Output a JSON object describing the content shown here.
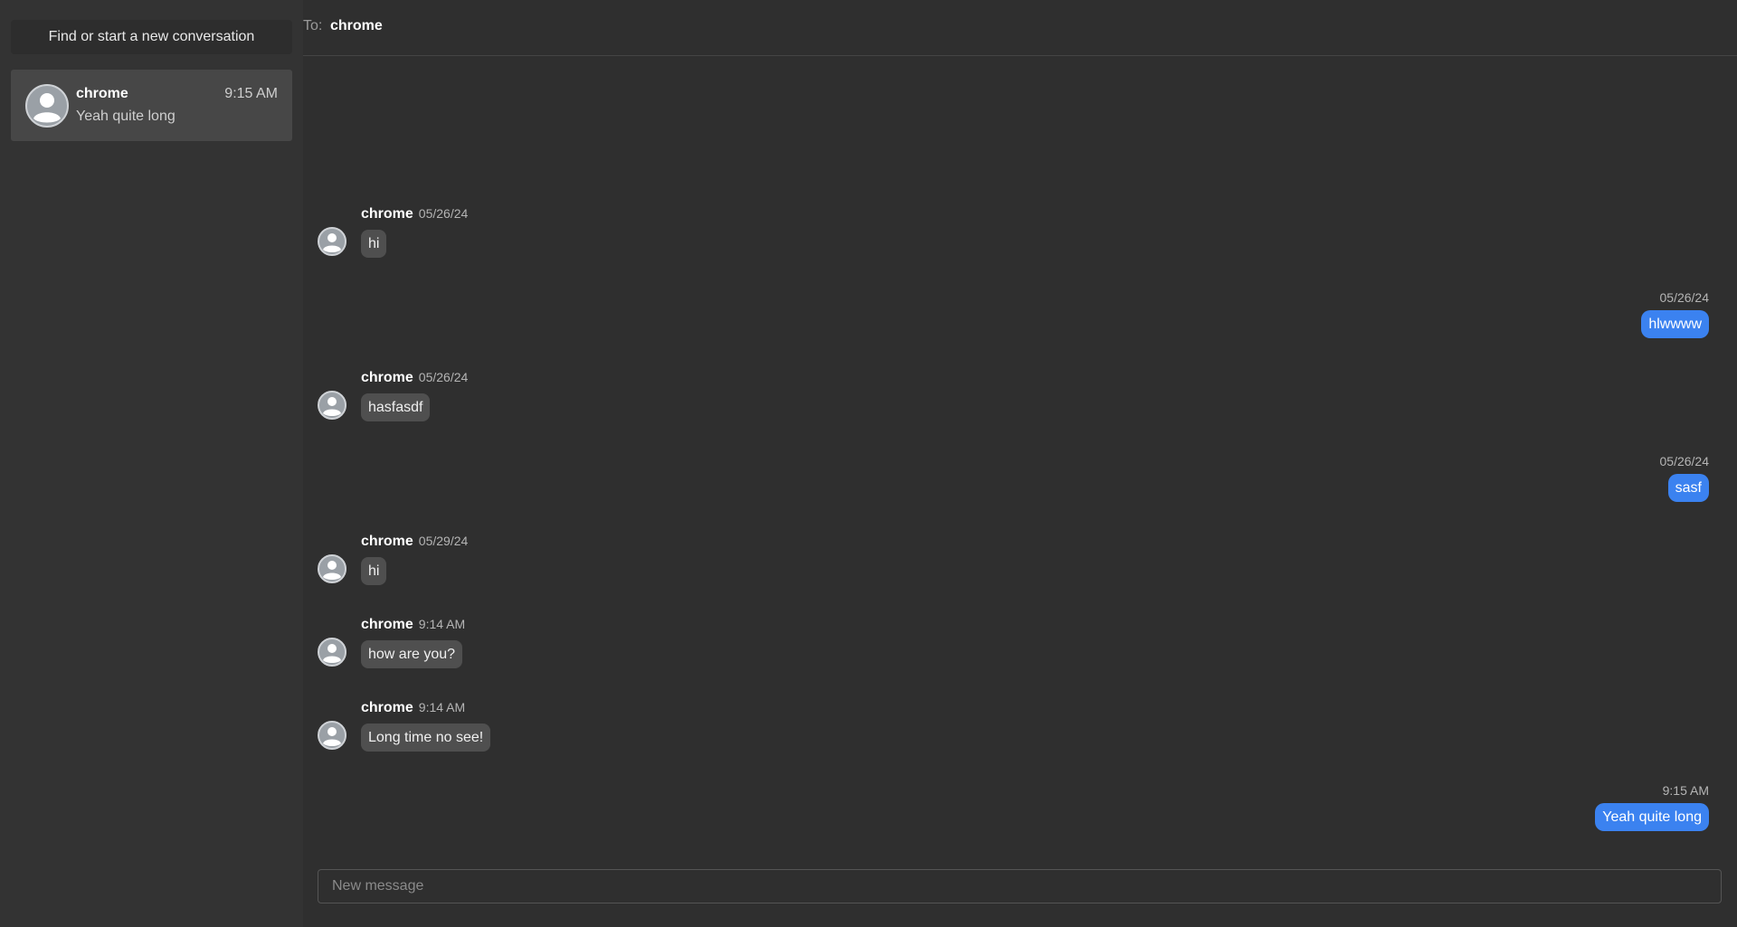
{
  "sidebar": {
    "new_conversation_label": "Find or start a new conversation",
    "conversations": [
      {
        "name": "chrome",
        "time": "9:15 AM",
        "preview": "Yeah quite long"
      }
    ]
  },
  "header": {
    "to_label": "To:",
    "recipient": "chrome"
  },
  "messages": [
    {
      "direction": "in",
      "sender": "chrome",
      "timestamp": "05/26/24",
      "text": "hi"
    },
    {
      "direction": "out",
      "timestamp": "05/26/24",
      "text": "hlwwww"
    },
    {
      "direction": "in",
      "sender": "chrome",
      "timestamp": "05/26/24",
      "text": "hasfasdf"
    },
    {
      "direction": "out",
      "timestamp": "05/26/24",
      "text": "sasf"
    },
    {
      "direction": "in",
      "sender": "chrome",
      "timestamp": "05/29/24",
      "text": "hi"
    },
    {
      "direction": "in",
      "sender": "chrome",
      "timestamp": "9:14 AM",
      "text": "how are you?"
    },
    {
      "direction": "in",
      "sender": "chrome",
      "timestamp": "9:14 AM",
      "text": "Long time no see!"
    },
    {
      "direction": "out",
      "timestamp": "9:15 AM",
      "text": "Yeah quite long"
    }
  ],
  "composer": {
    "placeholder": "New message",
    "value": ""
  },
  "colors": {
    "sent_bubble": "#3b82f0",
    "received_bubble": "#4f4f4f",
    "background": "#2f2f2f",
    "sidebar": "#333333"
  },
  "icons": {
    "avatar": "user-avatar-icon"
  }
}
